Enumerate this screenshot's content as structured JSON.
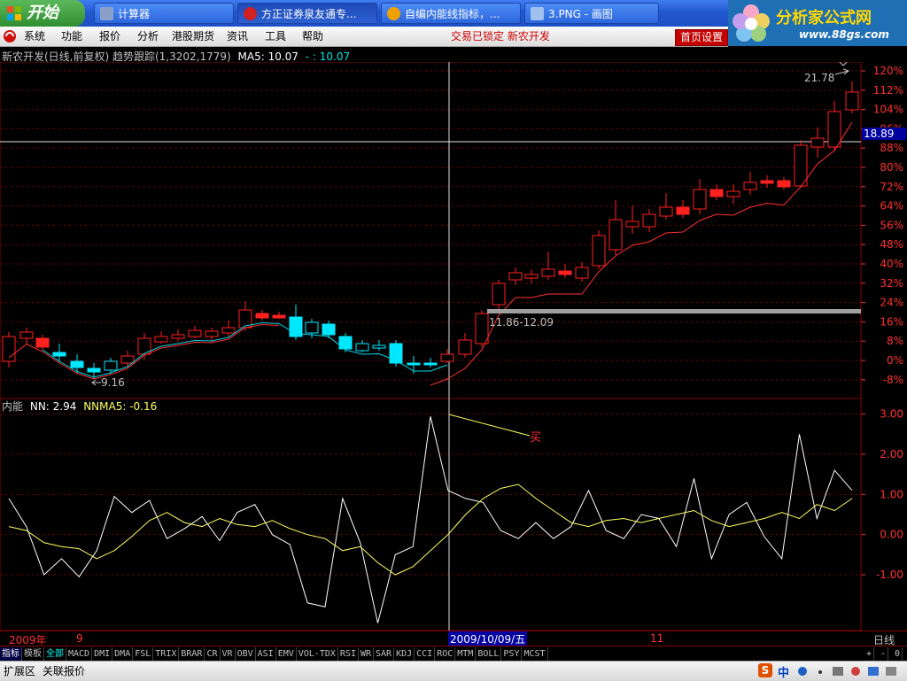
{
  "taskbar": {
    "start_label": "开始",
    "tasks": [
      {
        "label": "计算器",
        "color": "#8aa0c8"
      },
      {
        "label": "方正证券泉友通专...",
        "color": "#d02020"
      },
      {
        "label": "自编内能线指标，...",
        "color": "#f0a000"
      },
      {
        "label": "3.PNG - 画图",
        "color": "#a0c0f0"
      }
    ]
  },
  "logo": {
    "title": "分析家公式网",
    "url_text": "www.88gs.com"
  },
  "menu": {
    "items": [
      "系统",
      "功能",
      "报价",
      "分析",
      "港股期货",
      "资讯",
      "工具",
      "帮助"
    ],
    "lock_text": "交易已锁定  新农开发",
    "home_button": "首页设置"
  },
  "main_chart": {
    "header": "新农开发(日线,前复权) 趋势跟踪(1,3202,1779)",
    "ma_label": "MA5: 10.07",
    "ma_extra": "- : 10.07",
    "y_ticks": [
      "120%",
      "112%",
      "104%",
      "96%",
      "88%",
      "80%",
      "72%",
      "64%",
      "56%",
      "48%",
      "40%",
      "32%",
      "24%",
      "16%",
      "8%",
      "0%",
      "-8%"
    ],
    "price_tag": "18.89",
    "high_label": "21.78",
    "low_label": "9.16",
    "range_label": "11.86-12.09"
  },
  "chart_data": [
    {
      "type": "candlestick",
      "title": "新农开发(日线,前复权)",
      "ylim": [
        "-12%",
        "124%"
      ],
      "series": [
        {
          "name": "MA5",
          "last": 10.07
        }
      ],
      "annotations": [
        "21.78",
        "9.16",
        "11.86-12.09",
        "18.89"
      ]
    },
    {
      "type": "line",
      "title": "内能",
      "series": [
        {
          "name": "NN",
          "last": 2.94,
          "values": [
            0.9,
            0.2,
            -1.0,
            -0.6,
            -1.05,
            -0.4,
            0.95,
            0.55,
            0.85,
            -0.1,
            0.15,
            0.45,
            -0.15,
            0.55,
            0.75,
            0.0,
            -0.25,
            -1.7,
            -1.8,
            0.9,
            -0.2,
            -2.2,
            -0.5,
            -0.3,
            2.94,
            1.1,
            0.9,
            0.8,
            0.1,
            -0.1,
            0.3,
            -0.1,
            0.2,
            1.1,
            0.1,
            -0.1,
            0.5,
            0.4,
            -0.3,
            1.4,
            -0.6,
            0.5,
            0.8,
            -0.05,
            -0.6,
            2.5,
            0.4,
            1.6,
            1.1
          ]
        },
        {
          "name": "NNMA5",
          "last": -0.16,
          "values": [
            0.2,
            0.1,
            -0.2,
            -0.3,
            -0.35,
            -0.6,
            -0.4,
            -0.05,
            0.35,
            0.55,
            0.3,
            0.2,
            0.4,
            0.25,
            0.2,
            0.35,
            0.15,
            0.0,
            -0.1,
            -0.4,
            -0.3,
            -0.7,
            -1.0,
            -0.8,
            -0.4,
            0.0,
            0.5,
            0.9,
            1.15,
            1.25,
            0.9,
            0.6,
            0.3,
            0.2,
            0.35,
            0.4,
            0.3,
            0.4,
            0.5,
            0.6,
            0.35,
            0.2,
            0.3,
            0.4,
            0.55,
            0.4,
            0.75,
            0.6,
            0.9
          ]
        }
      ],
      "ylim": [
        -2.3,
        3.3
      ],
      "y_ticks": [
        "3.00",
        "2.00",
        "1.00",
        "0.00",
        "-1.00"
      ],
      "annotation": "买"
    }
  ],
  "sub_chart": {
    "name": "内能",
    "nn_label": "NN: 2.94",
    "nnma_label": "NNMA5: -0.16",
    "buy_label": "买",
    "y_ticks": [
      "3.00",
      "2.00",
      "1.00",
      "0.00",
      "-1.00"
    ]
  },
  "date_axis": {
    "year": "2009年",
    "m9": "9",
    "cursor_date": "2009/10/09/五",
    "m11": "11",
    "period": "日线"
  },
  "tabs": {
    "left": [
      "指标",
      "模板",
      "全部"
    ],
    "indicators": [
      "MACD",
      "DMI",
      "DMA",
      "FSL",
      "TRIX",
      "BRAR",
      "CR",
      "VR",
      "OBV",
      "ASI",
      "EMV",
      "VOL-TDX",
      "RSI",
      "WR",
      "SAR",
      "KDJ",
      "CCI",
      "ROC",
      "MTM",
      "BOLL",
      "PSY",
      "MCST"
    ],
    "right": [
      "+",
      "-",
      "0"
    ]
  },
  "status": {
    "left": "扩展区",
    "left2": "关联报价",
    "ime": "中"
  }
}
